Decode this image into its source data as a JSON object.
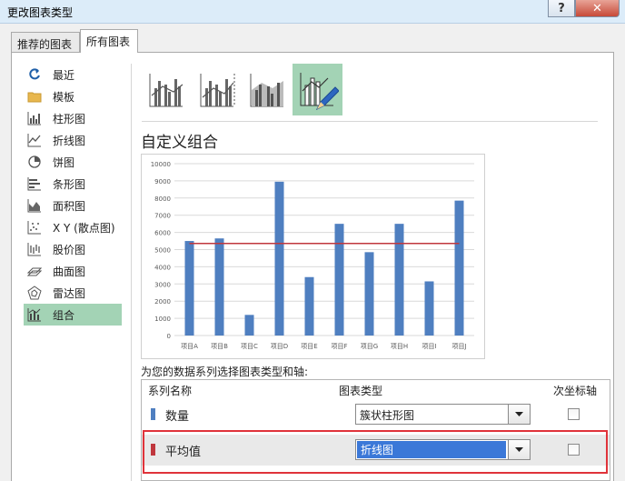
{
  "window": {
    "title": "更改图表类型",
    "help_label": "?",
    "close_label": "✕"
  },
  "tabs": [
    {
      "label": "推荐的图表",
      "active": false
    },
    {
      "label": "所有图表",
      "active": true
    }
  ],
  "sidebar": {
    "items": [
      {
        "label": "最近",
        "icon": "recent-icon"
      },
      {
        "label": "模板",
        "icon": "folder-icon"
      },
      {
        "label": "柱形图",
        "icon": "column-chart-icon"
      },
      {
        "label": "折线图",
        "icon": "line-chart-icon"
      },
      {
        "label": "饼图",
        "icon": "pie-chart-icon"
      },
      {
        "label": "条形图",
        "icon": "bar-chart-icon"
      },
      {
        "label": "面积图",
        "icon": "area-chart-icon"
      },
      {
        "label": "X Y (散点图)",
        "icon": "scatter-chart-icon"
      },
      {
        "label": "股价图",
        "icon": "stock-chart-icon"
      },
      {
        "label": "曲面图",
        "icon": "surface-chart-icon"
      },
      {
        "label": "雷达图",
        "icon": "radar-chart-icon"
      },
      {
        "label": "组合",
        "icon": "combo-chart-icon",
        "active": true
      }
    ]
  },
  "variants": [
    {
      "icon": "combo-column-line-icon",
      "selected": false
    },
    {
      "icon": "combo-column-line-secondary-icon",
      "selected": false
    },
    {
      "icon": "combo-area-column-icon",
      "selected": false
    },
    {
      "icon": "custom-combo-icon",
      "selected": true
    }
  ],
  "section_title": "自定义组合",
  "chart_data": {
    "type": "bar",
    "categories": [
      "项目A",
      "项目B",
      "项目C",
      "项目D",
      "项目E",
      "项目F",
      "项目G",
      "项目H",
      "项目I",
      "项目J"
    ],
    "series": [
      {
        "name": "数量",
        "type": "bar",
        "color": "#4f7fc0",
        "values": [
          5500,
          5650,
          1200,
          8950,
          3400,
          6500,
          4850,
          6500,
          3150,
          7850
        ]
      },
      {
        "name": "平均值",
        "type": "line",
        "color": "#c0373e",
        "values": [
          5355,
          5355,
          5355,
          5355,
          5355,
          5355,
          5355,
          5355,
          5355,
          5355
        ]
      }
    ],
    "yticks": [
      "0",
      "1000",
      "2000",
      "3000",
      "4000",
      "5000",
      "6000",
      "7000",
      "8000",
      "9000",
      "10000"
    ],
    "ylim": [
      0,
      10000
    ],
    "grid": true
  },
  "series_prompt": "为您的数据系列选择图表类型和轴:",
  "grid": {
    "headers": {
      "name": "系列名称",
      "type": "图表类型",
      "axis": "次坐标轴"
    },
    "rows": [
      {
        "name": "数量",
        "color": "#4f7fc0",
        "chart_type": "簇状柱形图",
        "secondary": false
      },
      {
        "name": "平均值",
        "color": "#c0373e",
        "chart_type": "折线图",
        "secondary": false
      }
    ]
  },
  "colors": {
    "accent_green": "#a3d3b5",
    "highlight_red": "#e0333a",
    "select_blue": "#3b78d8"
  }
}
